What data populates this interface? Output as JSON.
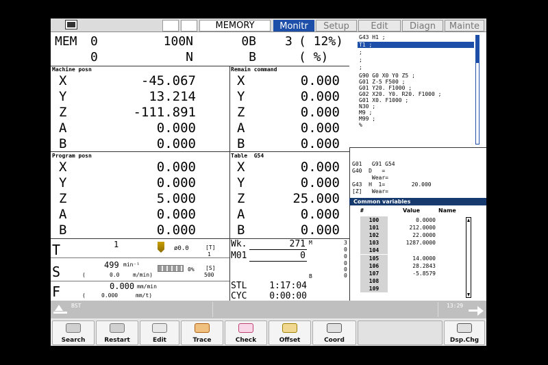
{
  "topbar": {
    "mode": "MEMORY",
    "tabs": [
      "Monitr",
      "Setup",
      "Edit",
      "Diagn",
      "Mainte"
    ]
  },
  "header": {
    "row1": {
      "mode": "MEM",
      "a": "0",
      "n": "100N",
      "b": "0B",
      "seq": "3",
      "pct": "( 12%)"
    },
    "row2": {
      "a": "0",
      "n": "N",
      "b": "B",
      "pct": "(   %)"
    }
  },
  "machine_posn": {
    "title": "Machine posn",
    "axes": [
      {
        "axis": "X",
        "value": "-45.067"
      },
      {
        "axis": "Y",
        "value": "13.214"
      },
      {
        "axis": "Z",
        "value": "-111.891"
      },
      {
        "axis": "A",
        "value": "0.000"
      },
      {
        "axis": "B",
        "value": "0.000"
      }
    ]
  },
  "remain_command": {
    "title": "Remain command",
    "axes": [
      {
        "axis": "X",
        "value": "0.000"
      },
      {
        "axis": "Y",
        "value": "0.000"
      },
      {
        "axis": "Z",
        "value": "0.000"
      },
      {
        "axis": "A",
        "value": "0.000"
      },
      {
        "axis": "B",
        "value": "0.000"
      }
    ]
  },
  "program_posn": {
    "title": "Program posn",
    "axes": [
      {
        "axis": "X",
        "value": "0.000"
      },
      {
        "axis": "Y",
        "value": "0.000"
      },
      {
        "axis": "Z",
        "value": "5.000"
      },
      {
        "axis": "A",
        "value": "0.000"
      },
      {
        "axis": "B",
        "value": "0.000"
      }
    ]
  },
  "table": {
    "title": "Table  G54",
    "axes": [
      {
        "axis": "X",
        "value": "0.000"
      },
      {
        "axis": "Y",
        "value": "0.000"
      },
      {
        "axis": "Z",
        "value": "25.000"
      },
      {
        "axis": "A",
        "value": "0.000"
      },
      {
        "axis": "B",
        "value": "0.000"
      }
    ]
  },
  "program": {
    "lines": [
      "G43 H1 ;",
      "T1 ;",
      ";",
      ";",
      ";",
      "G90 G0 X0 Y0 Z5 ;",
      "G01 Z-5 F500 ;",
      "G01 Y20. F1000 ;",
      "G02 X20. Y0. R20. F1000 ;",
      "G01 X0. F1000 ;",
      "N30 ;",
      "M9 ;",
      "M99 ;",
      "%"
    ],
    "highlight_index": 1
  },
  "modal": {
    "lines": [
      "G01   G91 G54",
      "G40  D   =",
      "      Wear=",
      "G43  H  1=        20.000",
      "[Z]   Wear="
    ]
  },
  "common_vars": {
    "title": "Common variables",
    "col_num": "#",
    "col_value": "Value",
    "col_name": "Name",
    "rows": [
      {
        "num": "100",
        "value": "0.0000"
      },
      {
        "num": "101",
        "value": "212.0000"
      },
      {
        "num": "102",
        "value": "22.0000"
      },
      {
        "num": "103",
        "value": "1287.0000"
      },
      {
        "num": "104",
        "value": ""
      },
      {
        "num": "105",
        "value": "14.0000"
      },
      {
        "num": "106",
        "value": "28.2843"
      },
      {
        "num": "107",
        "value": "-5.8579"
      },
      {
        "num": "108",
        "value": ""
      },
      {
        "num": "109",
        "value": ""
      }
    ]
  },
  "spindle": {
    "t_label": "T",
    "t_value": "1",
    "tool_dia": "ø0.0",
    "t_bracket": "[T]",
    "t_bracket_val": "1",
    "s_label": "S",
    "s_value": "499",
    "s_unit": "min⁻¹",
    "s_paren": "(",
    "s_speed": "0.0",
    "s_speed_unit": "m/min)",
    "load_pct": "0%",
    "s_bracket": "[S]",
    "s_bracket_val": "500",
    "f_label": "F",
    "f_value": "0.000",
    "f_unit": "mm/min",
    "f_paren": "(",
    "f_value2": "0.000",
    "f_unit2": "mm/t)"
  },
  "wk": {
    "wk_label": "Wk.",
    "wk_value": "271",
    "m_label": "M",
    "m01_label": "M01",
    "m01_value": "0",
    "m_values": [
      "3",
      "0",
      "0",
      "0",
      "0",
      "0"
    ],
    "b_label": "B",
    "stl_label": "STL",
    "stl_value": "1:17:04",
    "cyc_label": "CYC",
    "cyc_value": "0:00:00"
  },
  "status": {
    "bst": "BST",
    "time": "13:29"
  },
  "softkeys": [
    "Search",
    "Restart",
    "Edit",
    "Trace",
    "Check",
    "Offset",
    "Coord",
    "",
    "Dsp.Chg"
  ]
}
